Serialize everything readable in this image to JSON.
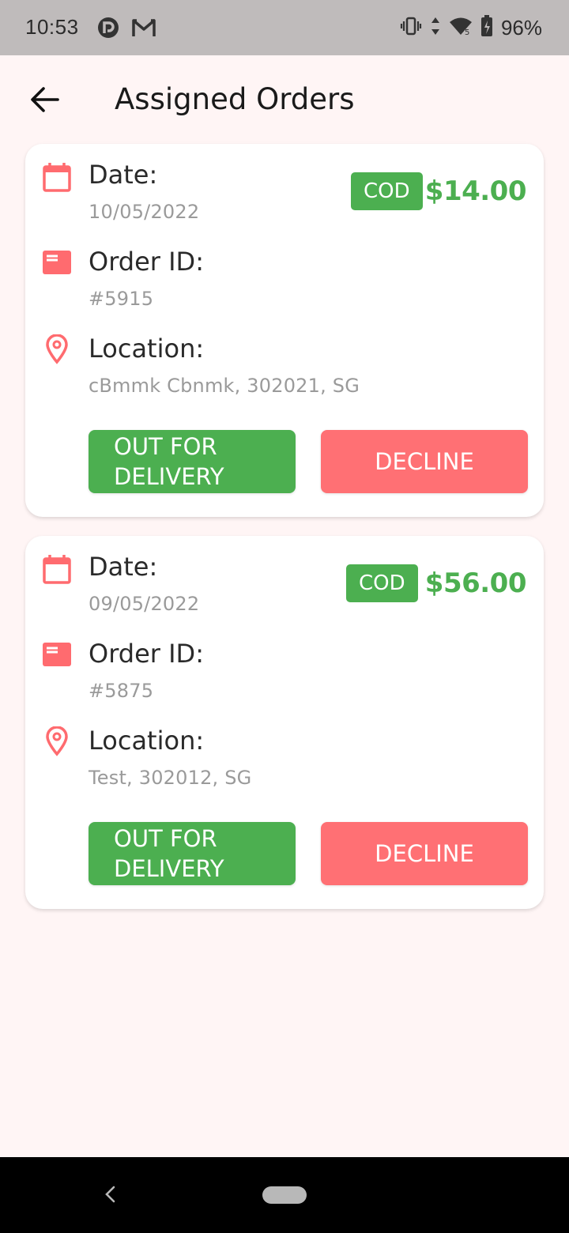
{
  "status_bar": {
    "time": "10:53",
    "battery_percent": "96%",
    "left_icons": [
      "pocketcasts-icon",
      "gmail-icon"
    ],
    "right_icons": [
      "vibrate-icon",
      "data-arrows-icon",
      "wifi-icon",
      "battery-charging-icon"
    ]
  },
  "header": {
    "title": "Assigned Orders",
    "back_icon": "arrow-left-icon"
  },
  "orders": [
    {
      "date_label": "Date:",
      "date": "10/05/2022",
      "payment_badge": "COD",
      "amount": "$14.00",
      "order_id_label": "Order ID:",
      "order_id": "#5915",
      "location_label": "Location:",
      "location": "cBmmk Cbnmk, 302021, SG",
      "out_for_delivery_label": "OUT FOR DELIVERY",
      "decline_label": "DECLINE"
    },
    {
      "date_label": "Date:",
      "date": "09/05/2022",
      "payment_badge": "COD",
      "amount": "$56.00",
      "order_id_label": "Order ID:",
      "order_id": "#5875",
      "location_label": "Location:",
      "location": "Test, 302012, SG",
      "out_for_delivery_label": "OUT FOR DELIVERY",
      "decline_label": "DECLINE"
    }
  ],
  "colors": {
    "accent_green": "#4caf50",
    "accent_red": "#ff7074",
    "icon_red": "#ff6b6f",
    "background": "#fff5f5"
  }
}
